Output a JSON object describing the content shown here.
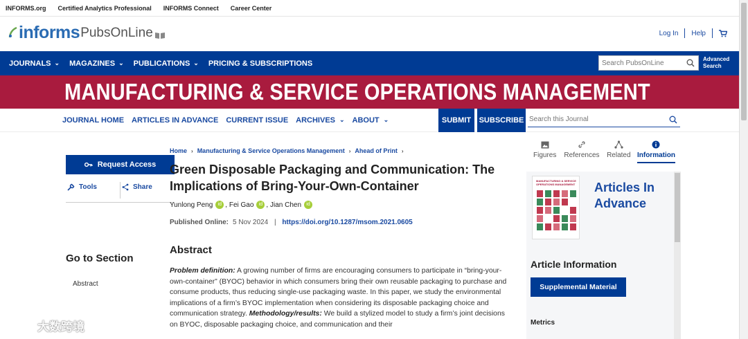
{
  "topbar": {
    "links": [
      "INFORMS.org",
      "Certified Analytics Professional",
      "INFORMS Connect",
      "Career Center"
    ]
  },
  "logo": {
    "brand": "informs",
    "suffix": "PubsOnLine"
  },
  "account": {
    "login": "Log In",
    "help": "Help"
  },
  "mainnav": {
    "items": [
      "JOURNALS",
      "MAGAZINES",
      "PUBLICATIONS",
      "PRICING & SUBSCRIPTIONS"
    ],
    "search_placeholder": "Search PubsOnLine",
    "advanced_search": "Advanced Search"
  },
  "journal": {
    "banner_title": "MANUFACTURING & SERVICE OPERATIONS MANAGEMENT",
    "nav": [
      "JOURNAL HOME",
      "ARTICLES IN ADVANCE",
      "CURRENT ISSUE",
      "ARCHIVES",
      "ABOUT"
    ],
    "submit": "SUBMIT",
    "subscribe": "SUBSCRIBE",
    "search_placeholder": "Search this Journal"
  },
  "leftrail": {
    "request_access": "Request Access",
    "tools": "Tools",
    "share": "Share",
    "goto_heading": "Go to Section",
    "goto_items": [
      "Abstract"
    ]
  },
  "article": {
    "breadcrumb": [
      "Home",
      "Manufacturing & Service Operations Management",
      "Ahead of Print"
    ],
    "title": "Green Disposable Packaging and Communication: The Implications of Bring-Your-Own-Container",
    "authors": [
      "Yunlong Peng",
      "Fei Gao",
      "Jian Chen"
    ],
    "published_label": "Published Online:",
    "published_date": "5 Nov 2024",
    "doi": "https://doi.org/10.1287/msom.2021.0605",
    "abstract_heading": "Abstract",
    "abstract_label1": "Problem definition:",
    "abstract_text1": " A growing number of firms are encouraging consumers to participate in “bring-your-own-container” (BYOC) behavior in which consumers bring their own reusable packaging to purchase and consume products, thus reducing single-use packaging waste. In this paper, we study the environmental implications of a firm’s BYOC implementation when considering its disposable packaging choice and communication strategy. ",
    "abstract_label2": "Methodology/results:",
    "abstract_text2": " We build a stylized model to study a firm’s joint decisions on BYOC, disposable packaging choice, and communication and their"
  },
  "sidebar": {
    "tabs": [
      {
        "label": "Figures",
        "icon": "image-icon"
      },
      {
        "label": "References",
        "icon": "link-icon"
      },
      {
        "label": "Related",
        "icon": "network-icon"
      },
      {
        "label": "Information",
        "icon": "info-icon"
      }
    ],
    "active_tab": "Information",
    "cover_title": "MANUFACTURING & SERVICE OPERATIONS MANAGEMENT",
    "aia_title": "Articles In Advance",
    "article_info_heading": "Article Information",
    "supplemental": "Supplemental Material",
    "metrics": "Metrics"
  },
  "watermark": {
    "text": "大数跨境"
  },
  "colors": {
    "brand_blue": "#003b94",
    "journal_red": "#a91b3e",
    "link_blue": "#1a4aa1",
    "orcid_green": "#a6ce39"
  }
}
